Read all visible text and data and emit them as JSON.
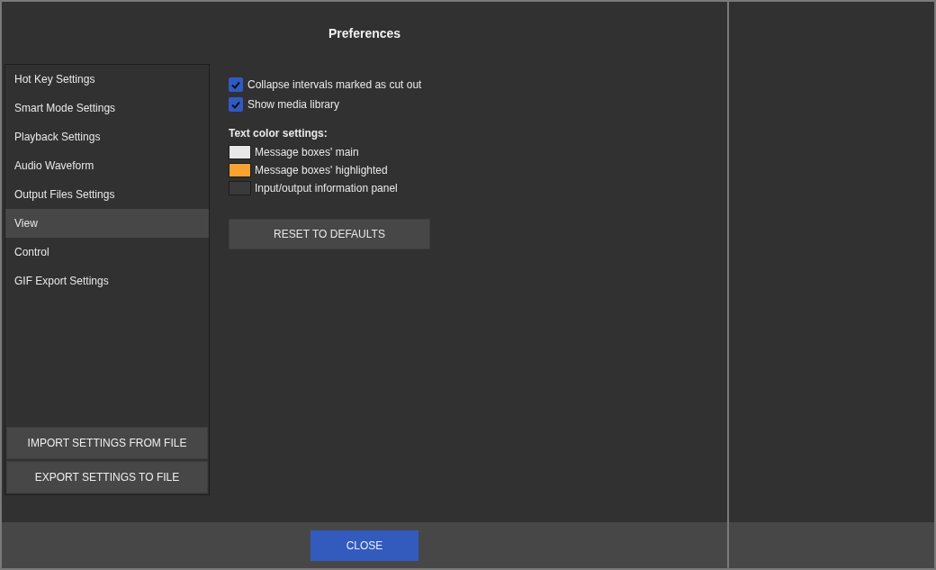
{
  "window": {
    "title": "Preferences"
  },
  "sidebar": {
    "items": [
      {
        "label": "Hot Key Settings",
        "selected": false
      },
      {
        "label": "Smart Mode Settings",
        "selected": false
      },
      {
        "label": "Playback Settings",
        "selected": false
      },
      {
        "label": "Audio Waveform",
        "selected": false
      },
      {
        "label": "Output Files Settings",
        "selected": false
      },
      {
        "label": "View",
        "selected": true
      },
      {
        "label": "Control",
        "selected": false
      },
      {
        "label": "GIF Export Settings",
        "selected": false
      }
    ],
    "buttons": [
      "IMPORT SETTINGS FROM FILE",
      "EXPORT SETTINGS TO FILE"
    ]
  },
  "options": [
    {
      "label": "Collapse intervals marked as cut out",
      "checked": true
    },
    {
      "label": "Show media library",
      "checked": true
    }
  ],
  "text_colors": {
    "heading": "Text color settings:",
    "items": [
      {
        "label": "Message boxes' main",
        "color": "#e8e8e8"
      },
      {
        "label": "Message boxes' highlighted",
        "color": "#f8a331"
      },
      {
        "label": "Input/output information panel",
        "color": "#3a3a3a"
      }
    ]
  },
  "reset_button": "RESET TO DEFAULTS",
  "footer": {
    "close_button": "CLOSE"
  }
}
